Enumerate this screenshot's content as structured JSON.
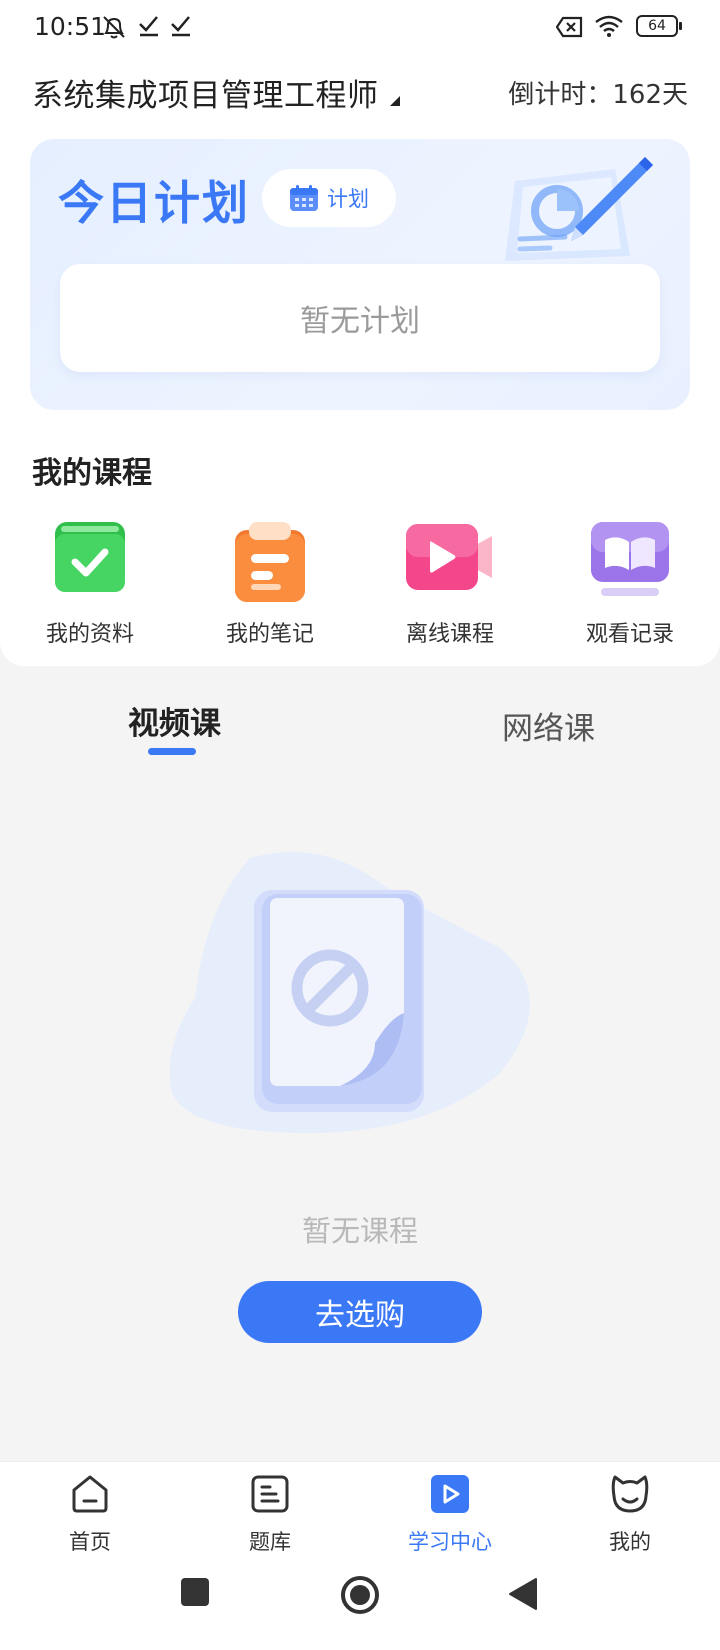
{
  "status_bar": {
    "time": "10:51",
    "battery": "64"
  },
  "header": {
    "title": "系统集成项目管理工程师",
    "countdown": "倒计时：162天"
  },
  "plan": {
    "title": "今日计划",
    "chip_label": "计划",
    "empty_text": "暂无计划"
  },
  "courses": {
    "section_title": "我的课程",
    "items": [
      {
        "label": "我的资料",
        "icon": "materials-icon"
      },
      {
        "label": "我的笔记",
        "icon": "notes-icon"
      },
      {
        "label": "离线课程",
        "icon": "offline-video-icon"
      },
      {
        "label": "观看记录",
        "icon": "watch-history-icon"
      }
    ]
  },
  "tabs": [
    {
      "label": "视频课"
    },
    {
      "label": "网络课"
    }
  ],
  "empty_state": {
    "text": "暂无课程",
    "button": "去选购"
  },
  "bottom_nav": [
    {
      "label": "首页",
      "icon": "home-icon"
    },
    {
      "label": "题库",
      "icon": "question-bank-icon"
    },
    {
      "label": "学习中心",
      "icon": "study-center-icon"
    },
    {
      "label": "我的",
      "icon": "profile-icon"
    }
  ],
  "colors": {
    "accent": "#3b78f6",
    "background": "#f4f4f4",
    "card_bg": "#e9f1ff"
  }
}
